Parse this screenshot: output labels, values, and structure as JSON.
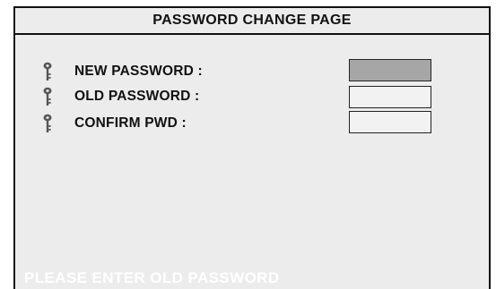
{
  "window": {
    "title": "PASSWORD CHANGE PAGE"
  },
  "fields": [
    {
      "label": "NEW PASSWORD :",
      "value": "",
      "state": "active",
      "icon": "key-icon"
    },
    {
      "label": "OLD PASSWORD :",
      "value": "",
      "state": "inactive",
      "icon": "key-icon"
    },
    {
      "label": "CONFIRM PWD :",
      "value": "",
      "state": "inactive",
      "icon": "key-icon"
    }
  ],
  "status_message": "PLEASE ENTER OLD PASSWORD",
  "colors": {
    "panel_background": "#ececec",
    "active_field": "#a6a6a6",
    "border": "#111111",
    "status_text": "#ffffff"
  }
}
